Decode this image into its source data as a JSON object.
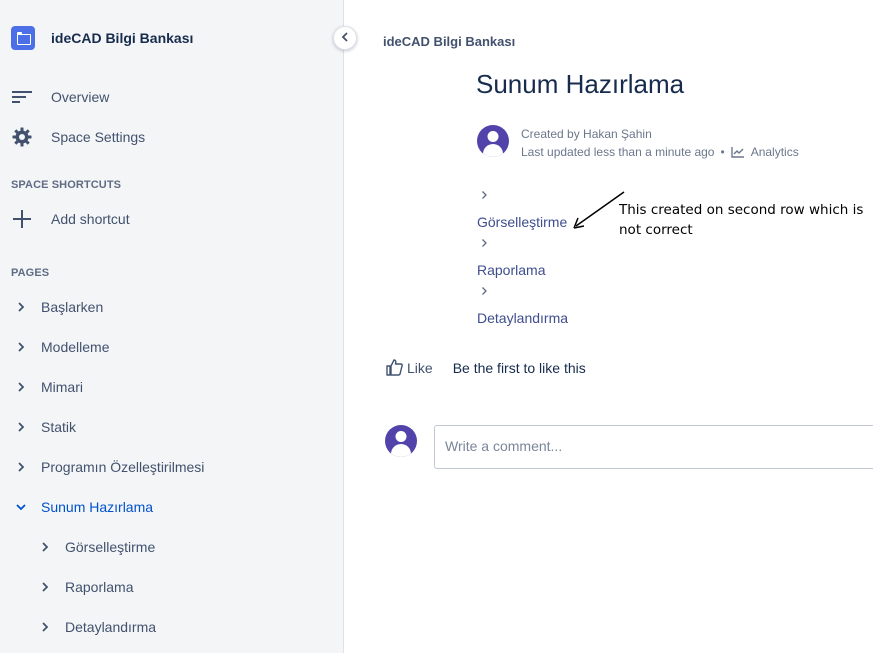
{
  "sidebar": {
    "space_name": "ideCAD Bilgi Bankası",
    "nav": [
      {
        "label": "Overview",
        "icon": "overview-lines-icon"
      },
      {
        "label": "Space Settings",
        "icon": "gear-icon"
      }
    ],
    "shortcuts_title": "SPACE SHORTCUTS",
    "add_shortcut": "Add shortcut",
    "pages_title": "PAGES",
    "pages": [
      {
        "label": "Başlarken"
      },
      {
        "label": "Modelleme"
      },
      {
        "label": "Mimari"
      },
      {
        "label": "Statik"
      },
      {
        "label": "Programın Özelleştirilmesi"
      },
      {
        "label": "Sunum Hazırlama",
        "expanded": true,
        "active": true
      },
      {
        "label": "Görselleştirme",
        "child": true
      },
      {
        "label": "Raporlama",
        "child": true
      },
      {
        "label": "Detaylandırma",
        "child": true
      }
    ],
    "accent_color": "#0052cc"
  },
  "main": {
    "breadcrumb": "ideCAD Bilgi Bankası",
    "title": "Sunum Hazırlama",
    "byline": {
      "created": "Created by Hakan Şahin",
      "updated": "Last updated less than a minute ago",
      "separator": "•",
      "analytics": "Analytics"
    },
    "children": [
      {
        "label": "Görselleştirme"
      },
      {
        "label": "Raporlama"
      },
      {
        "label": "Detaylandırma"
      }
    ],
    "annotation": "This created on second row which is not correct",
    "like": {
      "label": "Like",
      "text": "Be the first to like this"
    },
    "comment_placeholder": "Write a comment..."
  }
}
